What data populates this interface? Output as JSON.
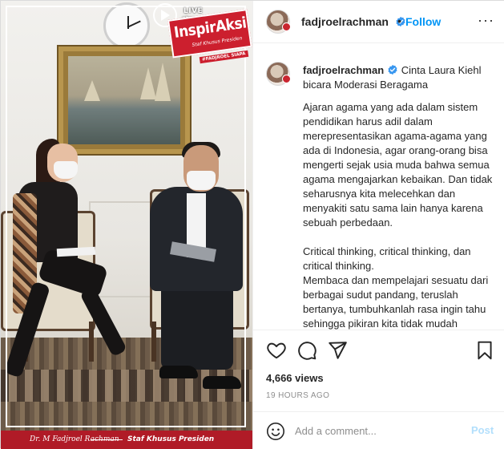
{
  "media": {
    "overlay": {
      "live": "LIVE",
      "stream": "stream",
      "brand": "InspirAksi",
      "brand_sub": "Staf Khusus Presiden",
      "brand_side": "#FADJROEL SIAPA"
    },
    "banner": {
      "left": "Dr. M Fadjroel Rachman",
      "right": "Staf Khusus Presiden"
    }
  },
  "header": {
    "username": "fadjroelrachman",
    "follow_label": "Follow",
    "more_label": "···"
  },
  "caption": {
    "username": "fadjroelrachman",
    "title": "Cinta Laura Kiehl bicara Moderasi Beragama",
    "paragraphs": [
      "Ajaran agama yang ada dalam sistem pendidikan harus adil dalam merepresentasikan agama-agama yang ada di Indonesia, agar orang-orang bisa mengerti sejak usia muda bahwa semua agama mengajarkan kebaikan. Dan tidak seharusnya kita melecehkan dan menyakiti satu sama lain hanya karena sebuah perbedaan.",
      "Critical thinking, critical thinking, dan critical thinking.",
      "Membaca dan mempelajari sesuatu dari berbagai sudut pandang, teruslah bertanya, tumbuhkanlah rasa ingin tahu sehingga pikiran kita tidak mudah dipengaruhi dan dijajah."
    ]
  },
  "stats": {
    "views": "4,666 views",
    "time": "19 HOURS AGO"
  },
  "comment": {
    "placeholder": "Add a comment...",
    "post_label": "Post"
  },
  "colors": {
    "link_blue": "#0095f6",
    "post_disabled": "#b2dffc",
    "brand_red": "#cc1f2e",
    "muted": "#8e8e8e"
  }
}
